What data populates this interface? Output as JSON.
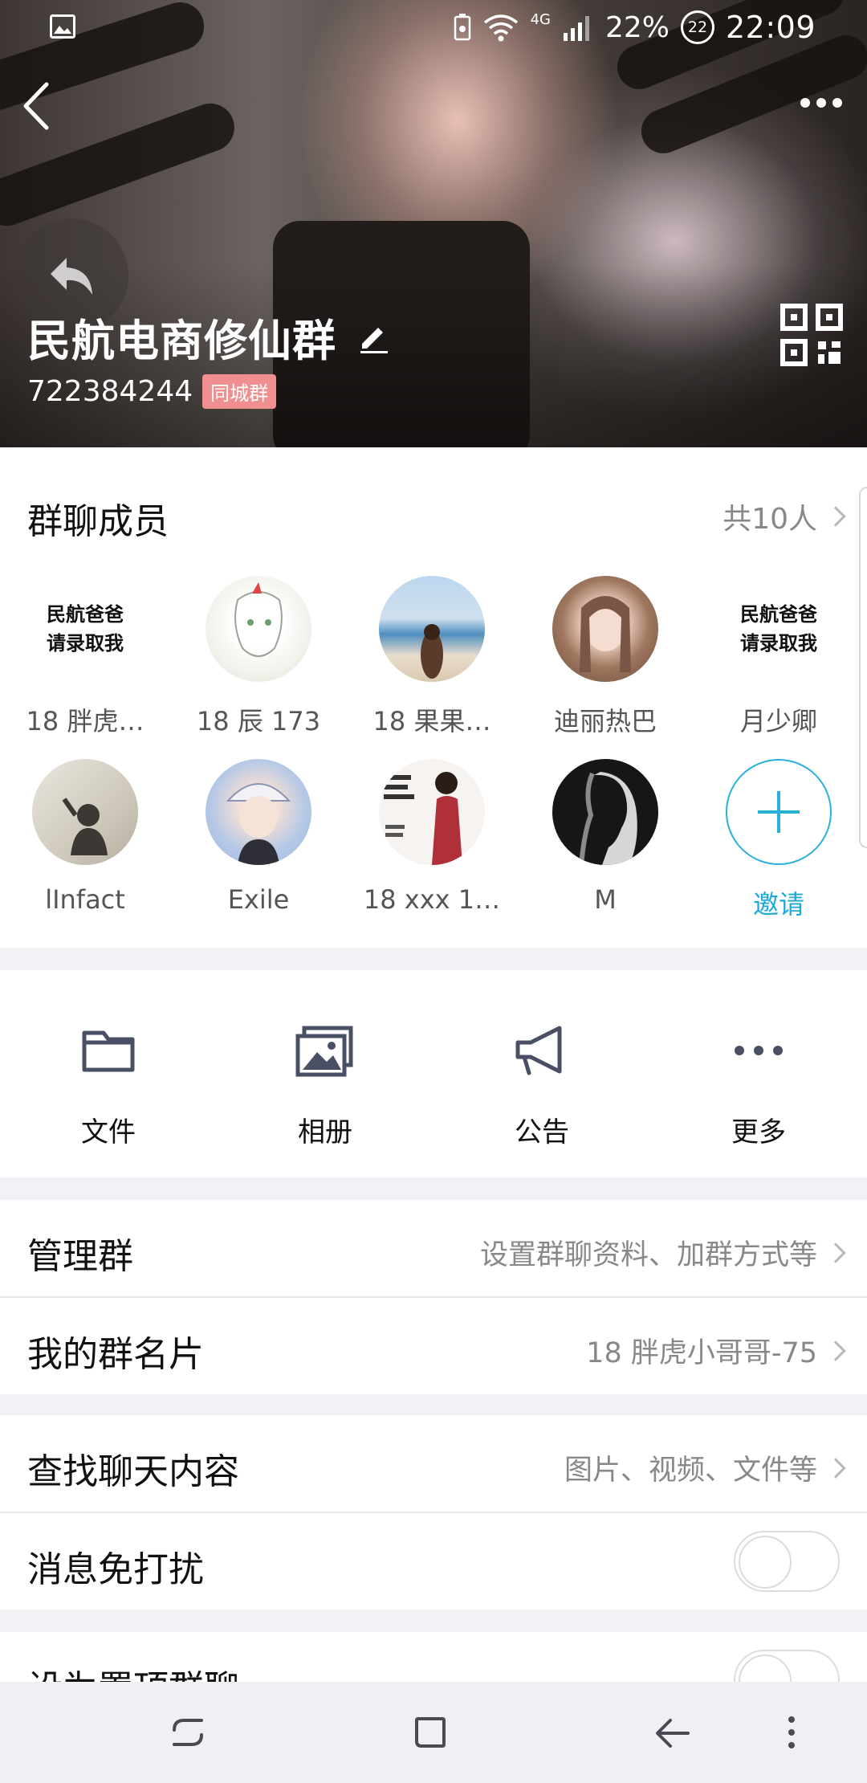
{
  "status_bar": {
    "network": "4G",
    "battery": "22%",
    "notification_count": "22",
    "time": "22:09"
  },
  "header": {
    "group_name": "民航电商修仙群",
    "group_id": "722384244",
    "badge": "同城群"
  },
  "members": {
    "title": "群聊成员",
    "count_label": "共10人",
    "list": [
      {
        "name": "18 胖虎…",
        "avatar_text": "民航爸爸\n请录取我"
      },
      {
        "name": "18 辰 173"
      },
      {
        "name": "18 果果…"
      },
      {
        "name": "迪丽热巴"
      },
      {
        "name": "月少卿",
        "avatar_text": "民航爸爸\n请录取我"
      },
      {
        "name": "lInfact"
      },
      {
        "name": "Exile"
      },
      {
        "name": "18 xxx 1…"
      },
      {
        "name": "M"
      }
    ],
    "invite_label": "邀请"
  },
  "tools": [
    {
      "label": "文件",
      "icon": "folder-icon"
    },
    {
      "label": "相册",
      "icon": "photo-album-icon"
    },
    {
      "label": "公告",
      "icon": "megaphone-icon"
    },
    {
      "label": "更多",
      "icon": "more-dots-icon"
    }
  ],
  "settings": {
    "manage": {
      "label": "管理群",
      "value": "设置群聊资料、加群方式等"
    },
    "card": {
      "label": "我的群名片",
      "value": "18 胖虎小哥哥-75"
    },
    "search": {
      "label": "查找聊天内容",
      "value": "图片、视频、文件等"
    },
    "mute": {
      "label": "消息免打扰"
    },
    "pin": {
      "label": "设为置顶群聊"
    }
  },
  "colors": {
    "accent": "#1ea8d9",
    "badge": "#f08f8f"
  }
}
